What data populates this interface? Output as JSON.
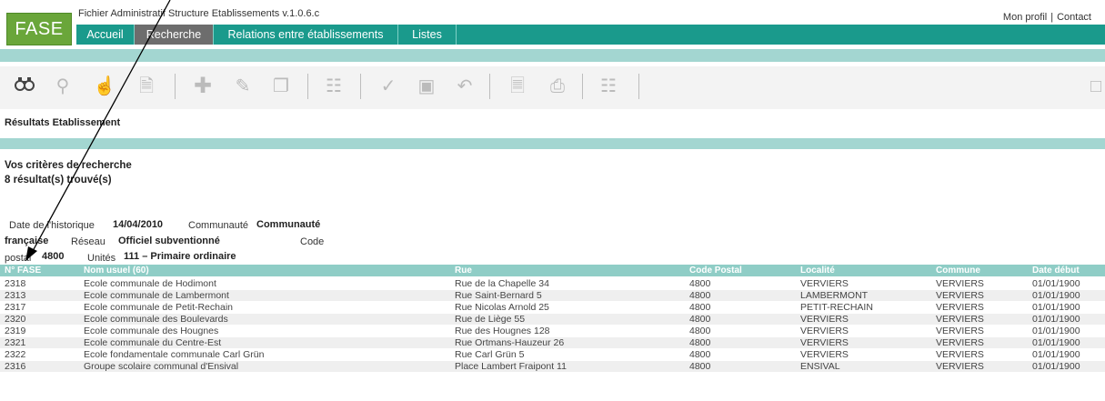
{
  "app": {
    "logo": "FASE",
    "title": "Fichier Administratif Structure Etablissements v.1.0.6.c",
    "links": [
      "Mon profil",
      "Contact"
    ]
  },
  "nav": [
    "Accueil",
    "Recherche",
    "Relations entre établissements",
    "Listes"
  ],
  "active_nav": "Recherche",
  "toolbar_icons": [
    "binoculars-icon",
    "search-icon",
    "hand-icon",
    "document-icon",
    "add-icon",
    "pencil-icon",
    "copy-icon",
    "delete-icon",
    "check-icon",
    "save-icon",
    "undo-icon",
    "print-preview-icon",
    "print-icon",
    "help-icon"
  ],
  "breadcrumb": "Résultats  Etablissement",
  "criteria": {
    "heading": "Vos critères de recherche",
    "count": "8 résultat(s) trouvé(s)",
    "date_label": "Date de l'historique",
    "date_value": "14/04/2010",
    "community_label": "Communauté",
    "community_value_1": "Communauté",
    "community_value_2": "française",
    "network_label": "Réseau",
    "network_value": "Officiel subventionné",
    "code_label_1": "Code",
    "code_label_2": "postal",
    "code_value": "4800",
    "units_label": "Unités",
    "units_value": "111 – Primaire ordinaire"
  },
  "table": {
    "columns": [
      "N° FASE",
      "Nom usuel (60)",
      "Rue",
      "Code Postal",
      "Localité",
      "Commune",
      "Date début"
    ],
    "rows": [
      [
        "2318",
        "Ecole communale de Hodimont",
        "Rue de la Chapelle 34",
        "4800",
        "VERVIERS",
        "VERVIERS",
        "01/01/1900"
      ],
      [
        "2313",
        "Ecole communale de Lambermont",
        "Rue Saint-Bernard 5",
        "4800",
        "LAMBERMONT",
        "VERVIERS",
        "01/01/1900"
      ],
      [
        "2317",
        "Ecole communale de Petit-Rechain",
        "Rue Nicolas Arnold 25",
        "4800",
        "PETIT-RECHAIN",
        "VERVIERS",
        "01/01/1900"
      ],
      [
        "2320",
        "Ecole communale des Boulevards",
        "Rue de Liège 55",
        "4800",
        "VERVIERS",
        "VERVIERS",
        "01/01/1900"
      ],
      [
        "2319",
        "Ecole communale des Hougnes",
        "Rue des Hougnes 128",
        "4800",
        "VERVIERS",
        "VERVIERS",
        "01/01/1900"
      ],
      [
        "2321",
        "Ecole communale du Centre-Est",
        "Rue Ortmans-Hauzeur 26",
        "4800",
        "VERVIERS",
        "VERVIERS",
        "01/01/1900"
      ],
      [
        "2322",
        "Ecole fondamentale communale Carl Grün",
        "Rue Carl Grün 5",
        "4800",
        "VERVIERS",
        "VERVIERS",
        "01/01/1900"
      ],
      [
        "2316",
        "Groupe scolaire communal d'Ensival",
        "Place Lambert Fraipont 11",
        "4800",
        "ENSIVAL",
        "VERVIERS",
        "01/01/1900"
      ]
    ]
  },
  "colors": {
    "brand": "#6aa63a",
    "nav": "#1a9a8c",
    "band": "#a3d6d1",
    "table_header": "#8fcdc6"
  }
}
